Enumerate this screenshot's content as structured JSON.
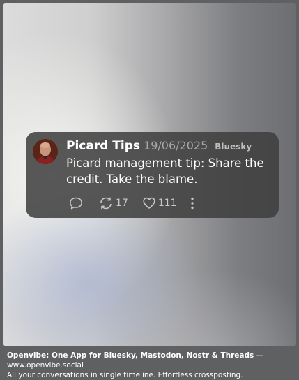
{
  "post": {
    "author": "Picard Tips",
    "date": "19/06/2025",
    "network": "Bluesky",
    "text": "Picard management tip: Share the credit. Take the blame.",
    "repost_count": "17",
    "like_count": "111"
  },
  "icons": {
    "reply": "speech-bubble-icon",
    "repost": "repost-arrows-icon",
    "like": "heart-icon",
    "more": "vertical-ellipsis-icon"
  },
  "footer": {
    "headline": "Openvibe: One App for Bluesky, Mastodon, Nostr & Threads",
    "separator": " — ",
    "url": "www.openvibe.social",
    "tagline": "All your conversations in single timeline. Effortless crossposting."
  },
  "colors": {
    "card": "#3e3e3e",
    "text": "#ffffff",
    "muted": "#a9a9a9"
  }
}
